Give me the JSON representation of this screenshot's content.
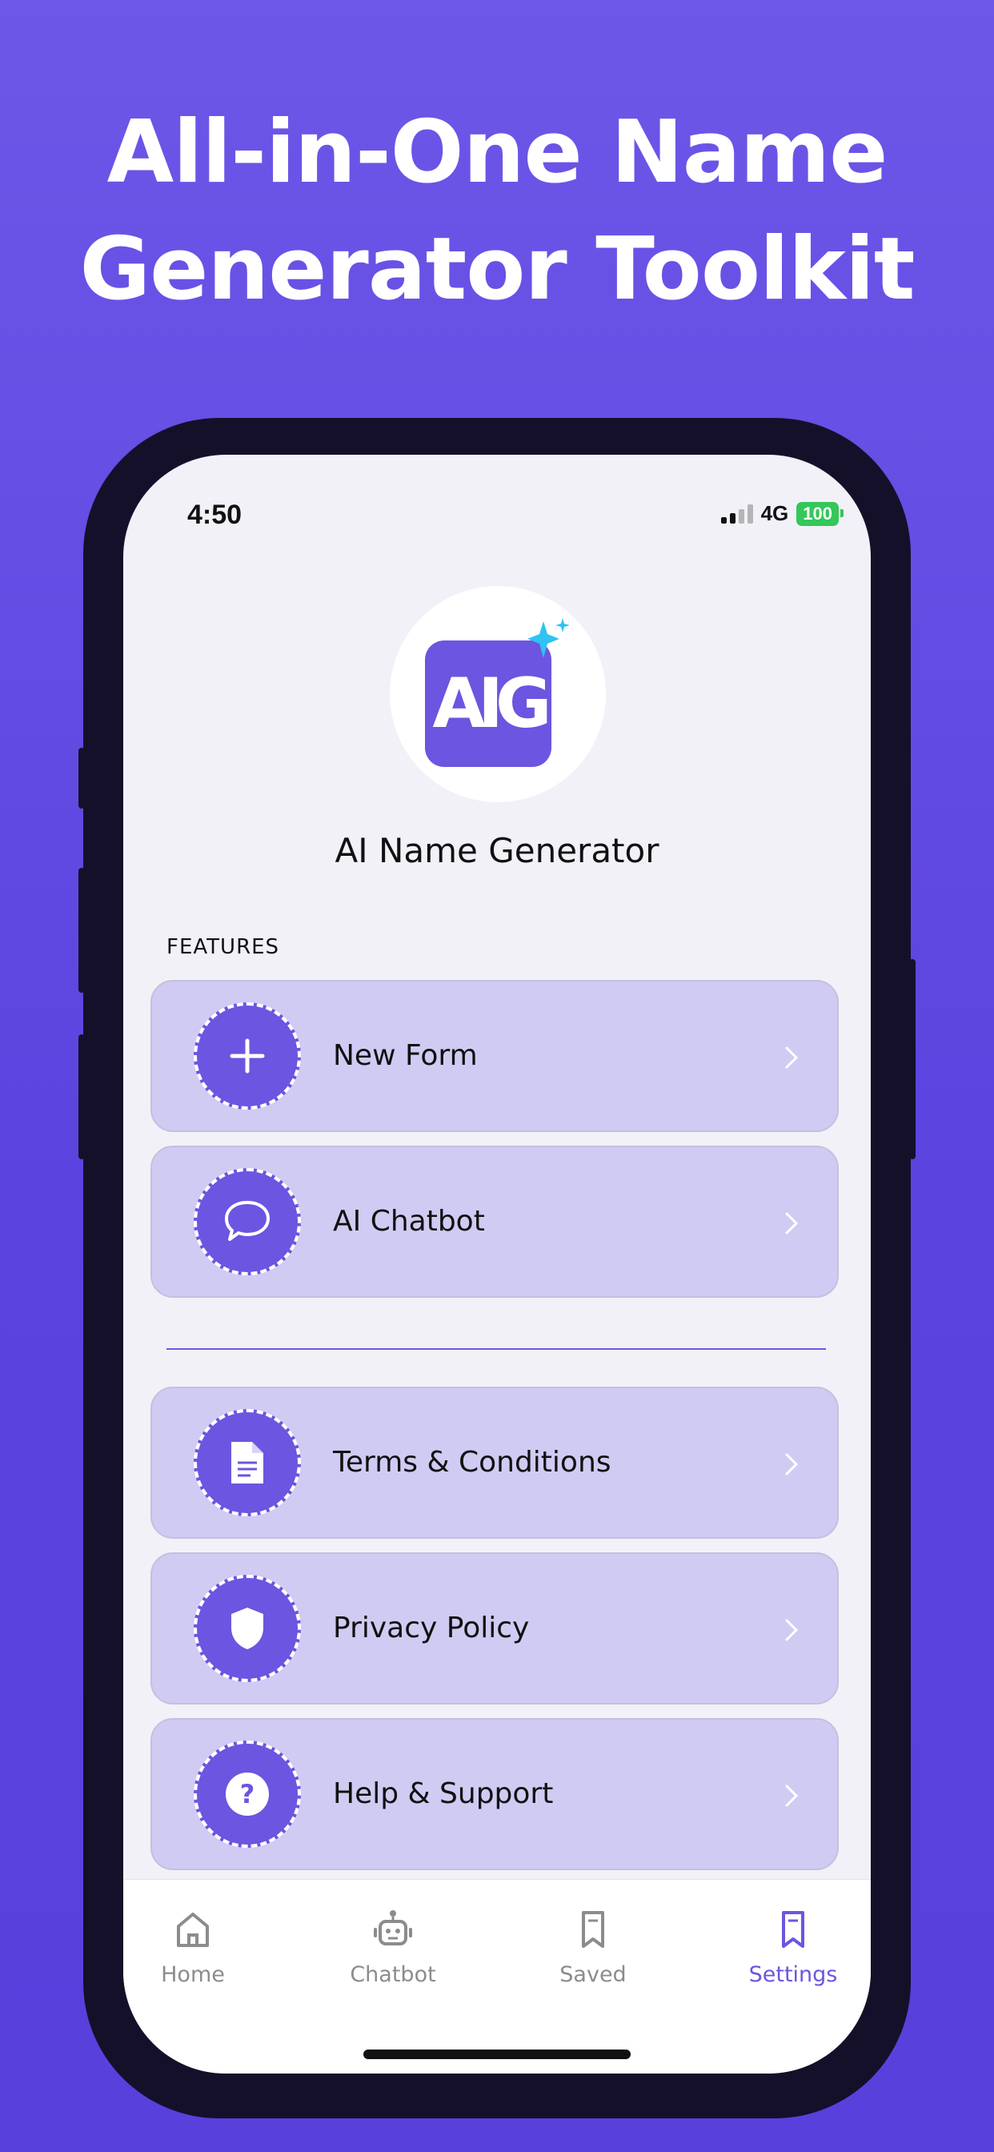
{
  "headline": {
    "line1": "All-in-One Name",
    "line2": "Generator Toolkit"
  },
  "status_bar": {
    "time": "4:50",
    "network": "4G",
    "battery": "100"
  },
  "app": {
    "logo_text": "AIG",
    "name": "AI Name Generator"
  },
  "features": {
    "section_label": "FEATURES",
    "items": [
      {
        "label": "New Form",
        "icon": "plus-icon"
      },
      {
        "label": "AI Chatbot",
        "icon": "chat-bubble-icon"
      }
    ]
  },
  "info": {
    "items": [
      {
        "label": "Terms & Conditions",
        "icon": "document-icon"
      },
      {
        "label": "Privacy Policy",
        "icon": "shield-icon"
      },
      {
        "label": "Help & Support",
        "icon": "question-icon"
      }
    ]
  },
  "tabbar": {
    "tabs": [
      {
        "label": "Home",
        "icon": "home-icon",
        "active": false
      },
      {
        "label": "Chatbot",
        "icon": "robot-icon",
        "active": false
      },
      {
        "label": "Saved",
        "icon": "bookmark-icon",
        "active": false
      },
      {
        "label": "Settings",
        "icon": "bookmark-icon",
        "active": true
      }
    ]
  },
  "colors": {
    "background": "#6c57e8",
    "accent": "#6c55e0",
    "card": "#d0cbf3",
    "battery": "#34c759"
  }
}
